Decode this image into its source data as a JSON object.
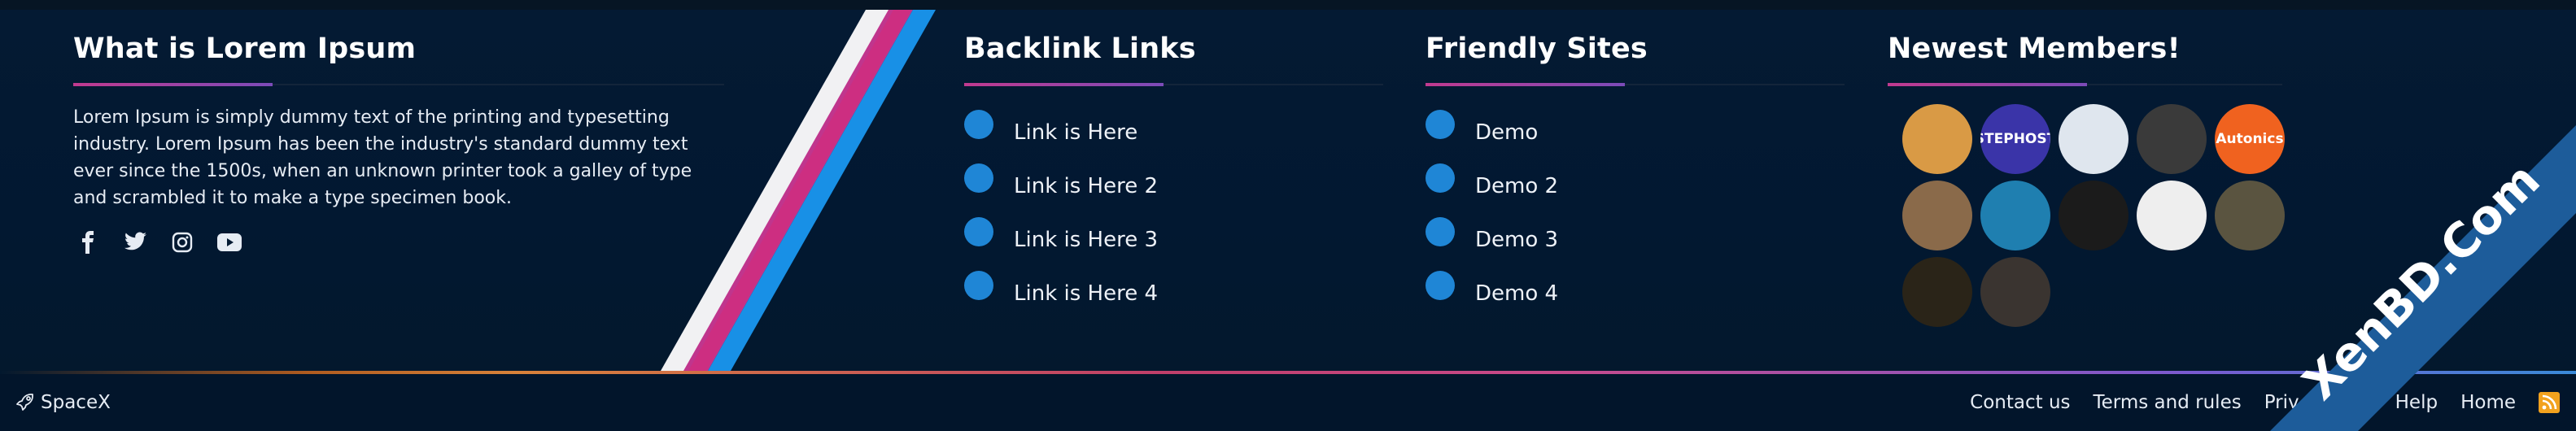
{
  "about": {
    "title": "What is Lorem Ipsum",
    "text": "Lorem Ipsum is simply dummy text of the printing and typesetting industry. Lorem Ipsum has been the industry's standard dummy text ever since the 1500s, when an unknown printer took a galley of type and scrambled it to make a type specimen book.",
    "social": [
      "facebook-icon",
      "twitter-icon",
      "instagram-icon",
      "youtube-icon"
    ]
  },
  "backlinks": {
    "title": "Backlink Links",
    "items": [
      "Link is Here",
      "Link is Here 2",
      "Link is Here 3",
      "Link is Here 4"
    ]
  },
  "friendly": {
    "title": "Friendly Sites",
    "items": [
      "Demo",
      "Demo 2",
      "Demo 3",
      "Demo 4"
    ]
  },
  "members": {
    "title": "Newest Members!",
    "avatars": [
      {
        "color": "#d99a45",
        "label": ""
      },
      {
        "color": "#3a34a8",
        "label": "STEPHOST"
      },
      {
        "color": "#dfe6ee",
        "label": ""
      },
      {
        "color": "#3a3a3a",
        "label": ""
      },
      {
        "color": "#f0621f",
        "label": "Autonics"
      },
      {
        "color": "#8a6a4a",
        "label": ""
      },
      {
        "color": "#1f7fb0",
        "label": ""
      },
      {
        "color": "#1b1b1b",
        "label": ""
      },
      {
        "color": "#eeeeee",
        "label": ""
      },
      {
        "color": "#5a5440",
        "label": ""
      },
      {
        "color": "#2a2418",
        "label": ""
      },
      {
        "color": "#3a3430",
        "label": ""
      }
    ]
  },
  "bottombar": {
    "brand": "SpaceX",
    "nav": [
      "Contact us",
      "Terms and rules",
      "Priv",
      "Help",
      "Home"
    ]
  },
  "watermark": "XenBD.Com",
  "colors": {
    "background": "#031a33",
    "accent_blue": "#1f86d6",
    "stripe_white": "#f1f1f3",
    "stripe_pink": "#c0358d",
    "stripe_magenta": "#d62a7a",
    "stripe_blue": "#1890e6",
    "rss": "#f2a21e"
  }
}
